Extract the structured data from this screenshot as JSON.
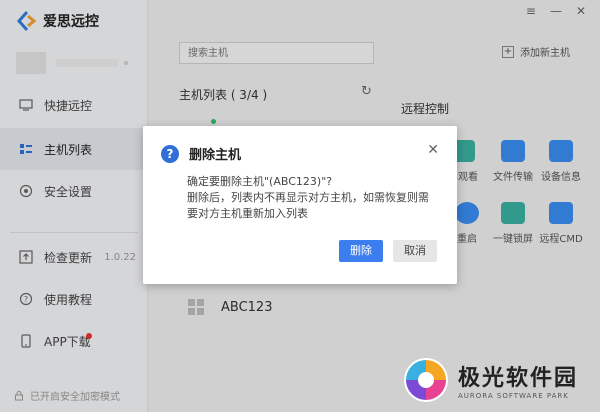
{
  "app": {
    "name": "爱思远控"
  },
  "sidebar": {
    "items": [
      {
        "label": "快捷远控"
      },
      {
        "label": "主机列表"
      },
      {
        "label": "安全设置"
      },
      {
        "label": "检查更新",
        "version": "1.0.22"
      },
      {
        "label": "使用教程"
      },
      {
        "label": "APP下载"
      }
    ],
    "encryption": "已开启安全加密模式"
  },
  "main": {
    "search_placeholder": "搜索主机",
    "add_host": "添加新主机",
    "list_title": "主机列表 ( 3/4 )",
    "remote_control_title": "远程控制",
    "tiles": [
      {
        "label": "屏观看"
      },
      {
        "label": "文件传输"
      },
      {
        "label": "设备信息"
      },
      {
        "label": "重启"
      },
      {
        "label": "一键锁屏"
      },
      {
        "label": "远程CMD"
      }
    ],
    "host_item": "ABC123"
  },
  "dialog": {
    "title": "删除主机",
    "line1": "确定要删除主机\"(ABC123)\"?",
    "line2": "删除后，列表内不再显示对方主机，如需恢复则需要对方主机重新加入列表",
    "delete_label": "删除",
    "cancel_label": "取消"
  },
  "watermark": {
    "cn": "极光软件园",
    "en": "AURORA SOFTWARE PARK"
  },
  "colors": {
    "accent": "#3c7df0",
    "online": "#2ec26a",
    "badge": "#e33333"
  }
}
